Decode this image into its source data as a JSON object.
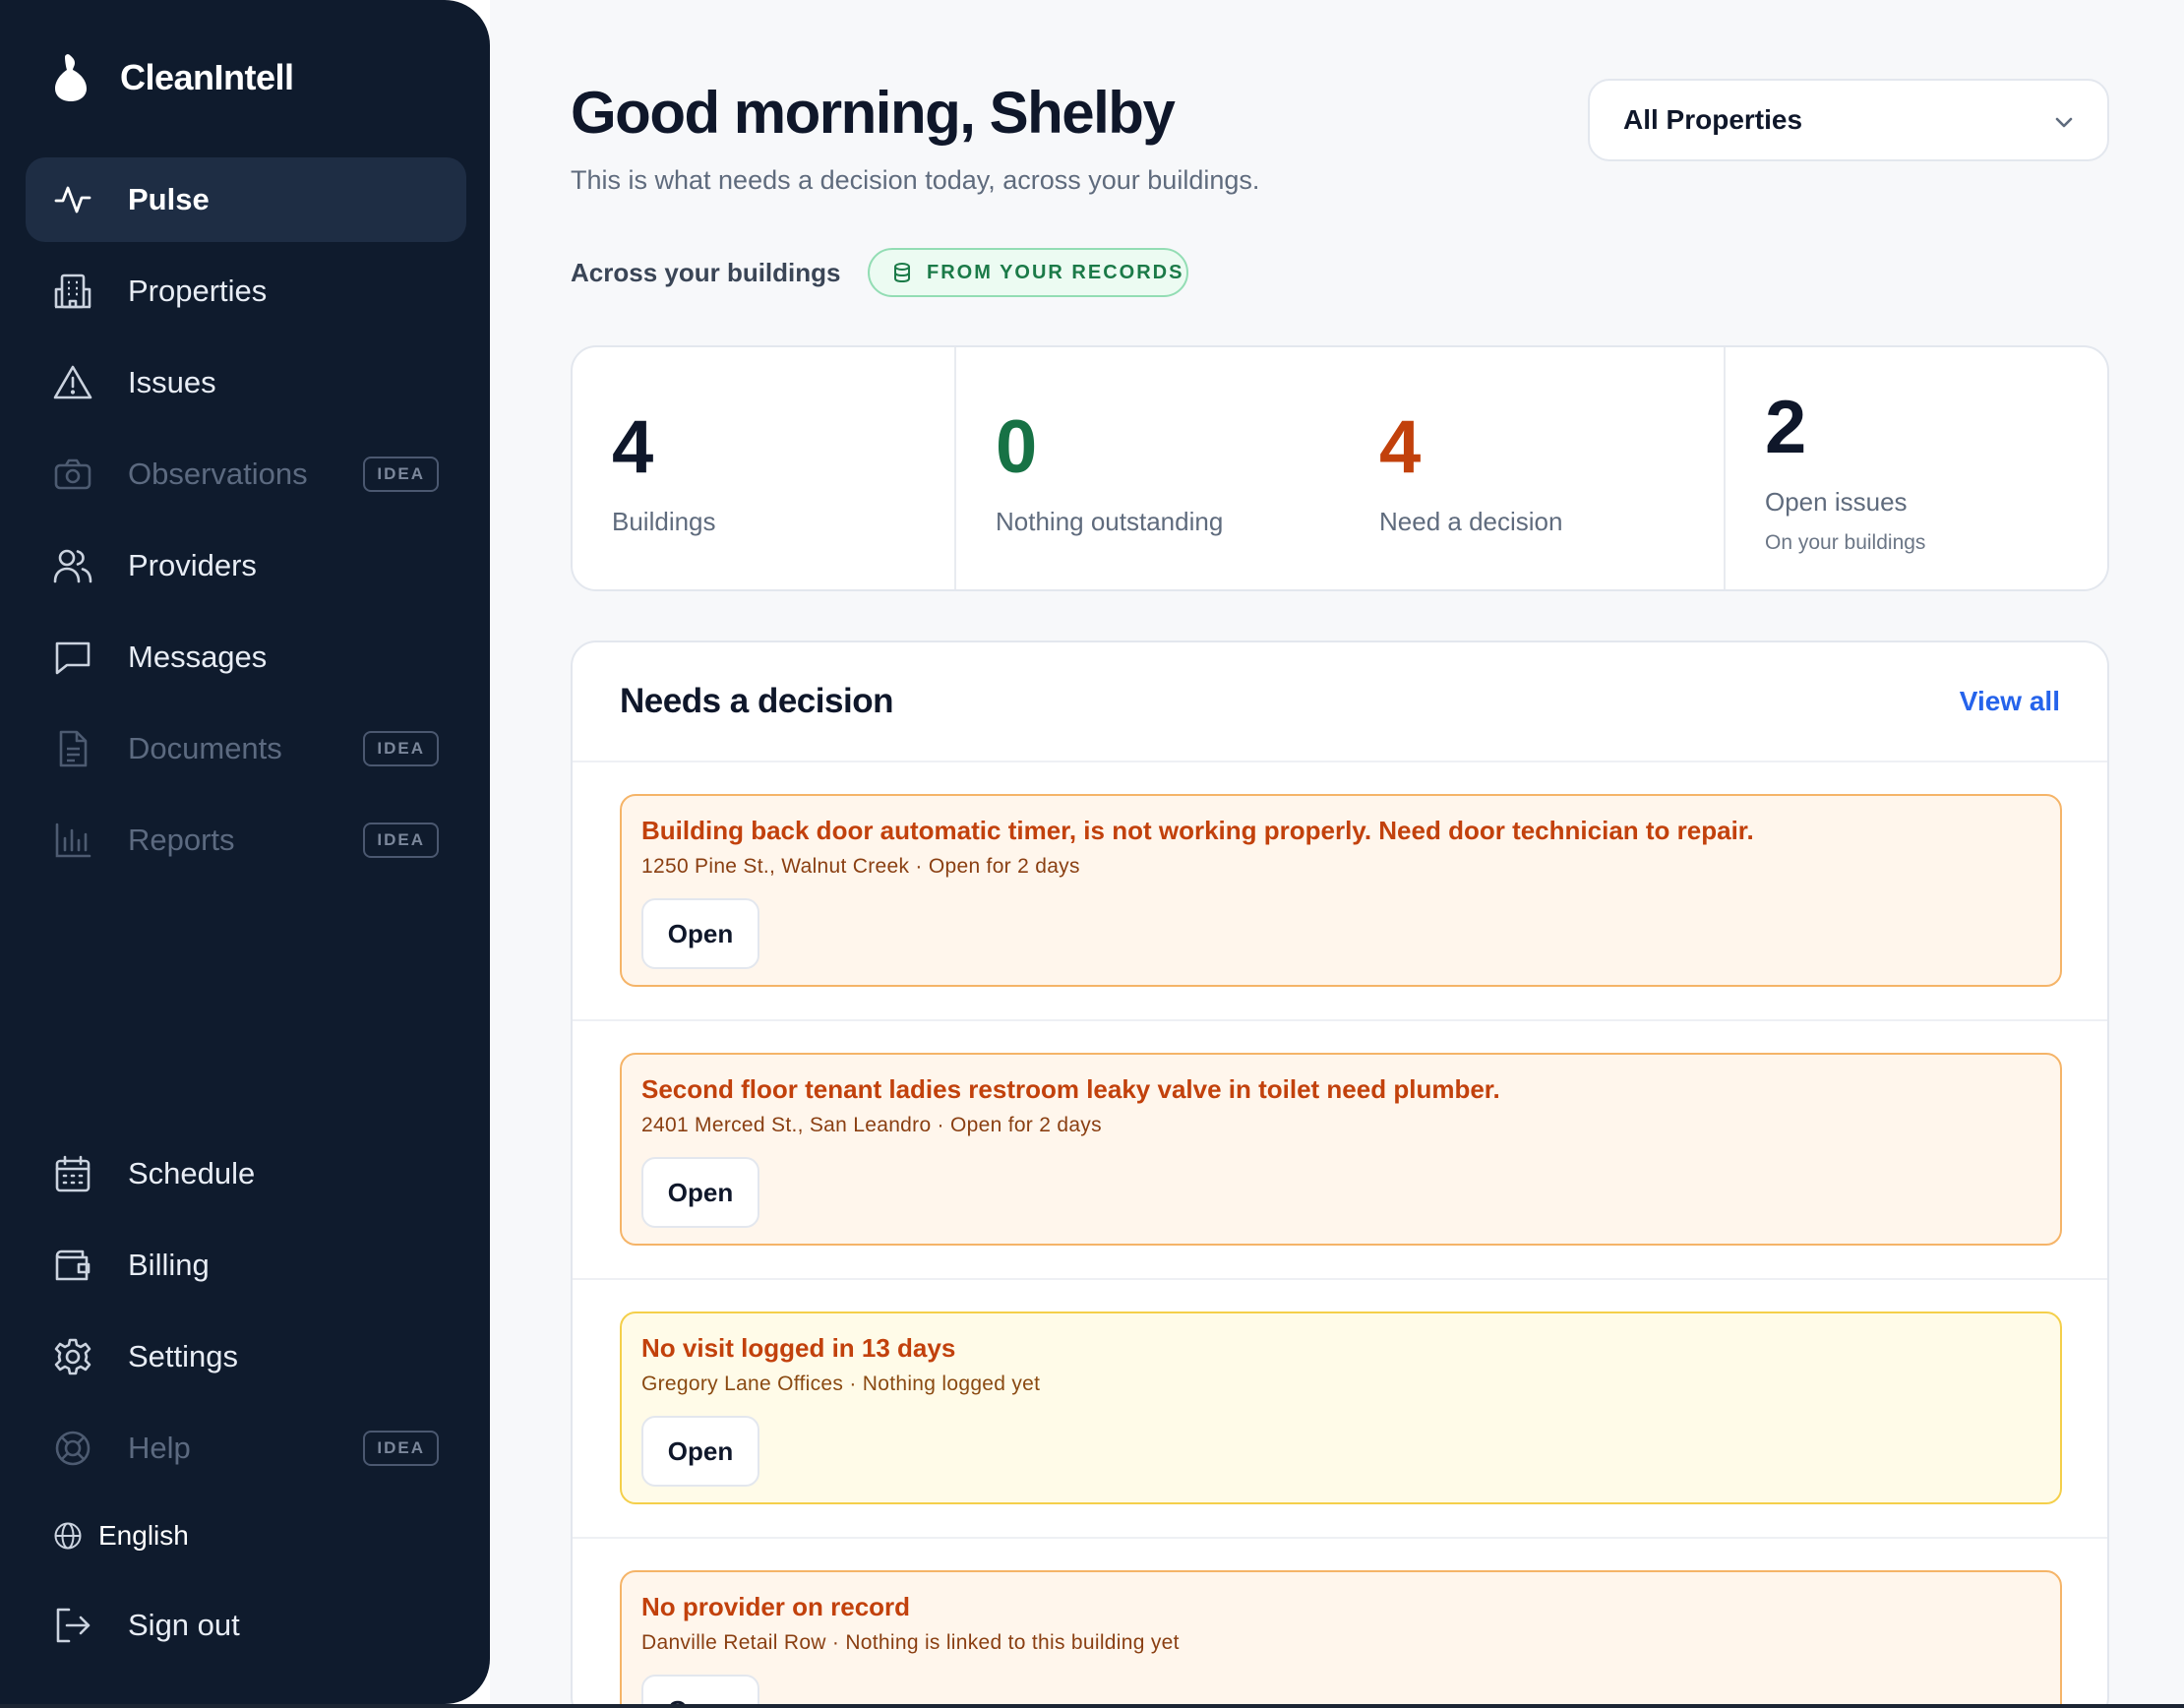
{
  "app": {
    "name": "CleanIntell"
  },
  "sidebar": {
    "items": [
      {
        "label": "Pulse",
        "icon": "pulse-icon",
        "active": true
      },
      {
        "label": "Properties",
        "icon": "building-icon"
      },
      {
        "label": "Issues",
        "icon": "warning-icon"
      },
      {
        "label": "Observations",
        "icon": "camera-icon",
        "badge": "IDEA"
      },
      {
        "label": "Providers",
        "icon": "users-icon"
      },
      {
        "label": "Messages",
        "icon": "message-icon"
      },
      {
        "label": "Documents",
        "icon": "document-icon",
        "badge": "IDEA"
      },
      {
        "label": "Reports",
        "icon": "bar-chart-icon",
        "badge": "IDEA"
      },
      {
        "label": "Schedule",
        "icon": "calendar-icon"
      },
      {
        "label": "Billing",
        "icon": "wallet-icon"
      },
      {
        "label": "Settings",
        "icon": "gear-icon"
      },
      {
        "label": "Help",
        "icon": "lifebuoy-icon",
        "badge": "IDEA"
      }
    ],
    "language": "English",
    "sign_out": "Sign out"
  },
  "header": {
    "greeting": "Good morning, Shelby",
    "subtitle": "This is what needs a decision today, across your buildings.",
    "property_filter": "All Properties"
  },
  "summary": {
    "label": "Across your buildings",
    "source_badge": "FROM YOUR RECORDS",
    "stats": [
      {
        "value": "4",
        "label": "Buildings",
        "color": "#0f172a"
      },
      {
        "value": "0",
        "label": "Nothing outstanding",
        "color": "#177245"
      },
      {
        "value": "4",
        "label": "Need a decision",
        "color": "#c2410c"
      },
      {
        "value": "2",
        "label": "Open issues",
        "sub": "On your buildings",
        "color": "#0f172a"
      }
    ]
  },
  "decisions": {
    "title": "Needs a decision",
    "view_all": "View all",
    "items": [
      {
        "title": "Building back door automatic timer, is not working properly. Need door technician to repair.",
        "meta": "1250 Pine St., Walnut Creek · Open for 2 days",
        "action": "Open"
      },
      {
        "title": "Second floor tenant ladies restroom leaky valve in toilet need plumber.",
        "meta": "2401 Merced St., San Leandro · Open for 2 days",
        "action": "Open"
      },
      {
        "title": "No visit logged in 13 days",
        "meta": "Gregory Lane Offices · Nothing logged yet",
        "action": "Open"
      },
      {
        "title": "No provider on record",
        "meta": "Danville Retail Row · Nothing is linked to this building yet",
        "action": "Open"
      }
    ]
  },
  "colors": {
    "sidebar_bg": "#0f1b2d",
    "accent_link": "#2563eb",
    "warning_text": "#c2410c",
    "success_text": "#177245"
  }
}
